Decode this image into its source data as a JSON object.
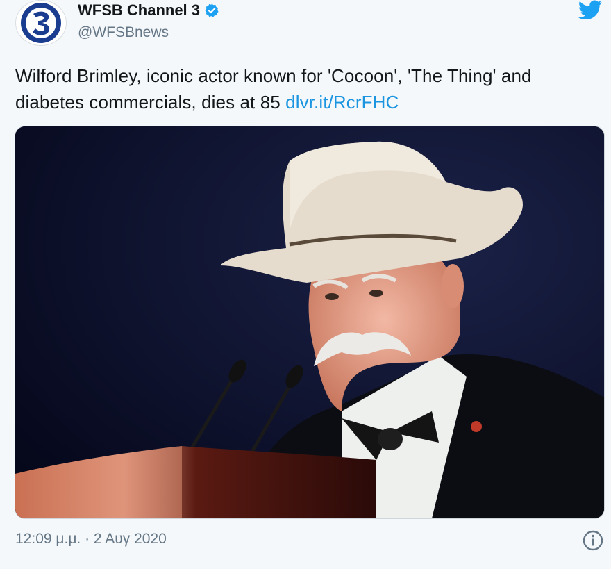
{
  "account": {
    "display_name": "WFSB Channel 3",
    "handle": "@WFSBnews",
    "avatar_icon": "channel-3-logo",
    "verified_icon": "verified-badge-icon"
  },
  "tweet": {
    "text": "Wilford Brimley, iconic actor known for 'Cocoon', 'The Thing' and diabetes commercials, dies at 85",
    "link": "dlvr.it/RcrFHC"
  },
  "meta": {
    "timestamp": "12:09 μ.μ. · 2 Αυγ 2020",
    "info_icon": "info-icon",
    "brand_icon": "twitter-bird-icon"
  },
  "colors": {
    "link": "#1b95e0",
    "verified": "#1da1f2",
    "secondary_text": "#657786"
  }
}
